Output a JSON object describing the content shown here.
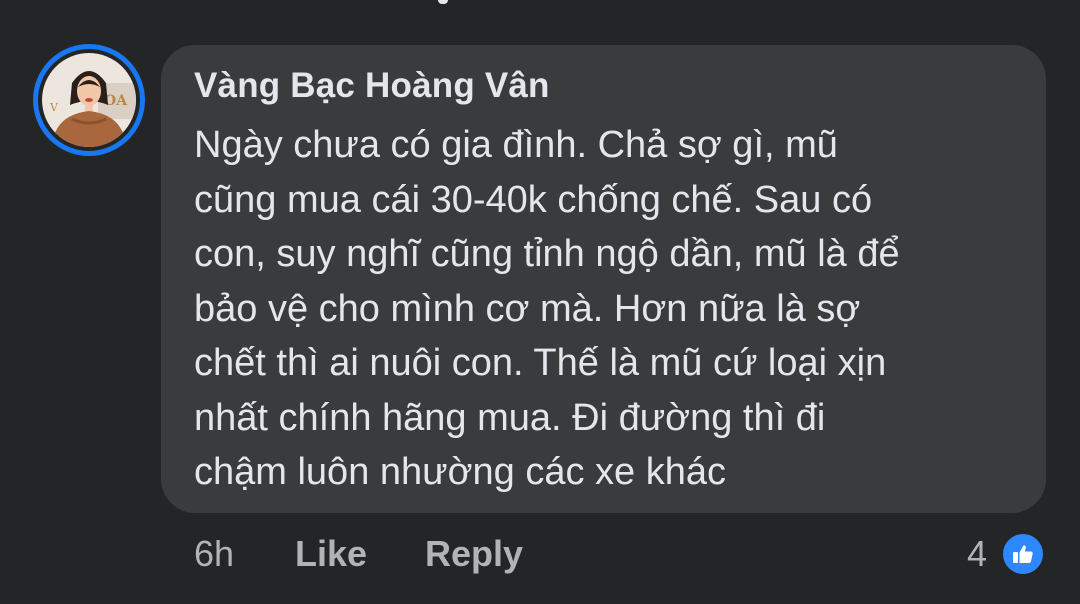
{
  "comment": {
    "author": "Vàng Bạc Hoàng Vân",
    "text_lines": [
      "Ngày chưa có gia đình. Chả sợ gì, mũ",
      "cũng mua cái 30-40k chống chế. Sau có",
      "con, suy nghĩ cũng tỉnh ngộ dần, mũ là để",
      "bảo vệ cho mình cơ mà. Hơn nữa là sợ",
      "chết thì ai nuôi con. Thế là mũ cứ loại xịn",
      "nhất chính hãng mua. Đi đường thì đi",
      "chậm luôn nhường các xe khác"
    ],
    "time": "6h",
    "like_label": "Like",
    "reply_label": "Reply",
    "reaction_count": "4",
    "reaction_icon": "thumbs-up-icon"
  },
  "colors": {
    "background": "#242526",
    "bubble": "#3a3b3c",
    "primary_text": "#e4e6eb",
    "secondary_text": "#b0b3b8",
    "accent": "#1877f2",
    "like_blue": "#2d88ff"
  }
}
